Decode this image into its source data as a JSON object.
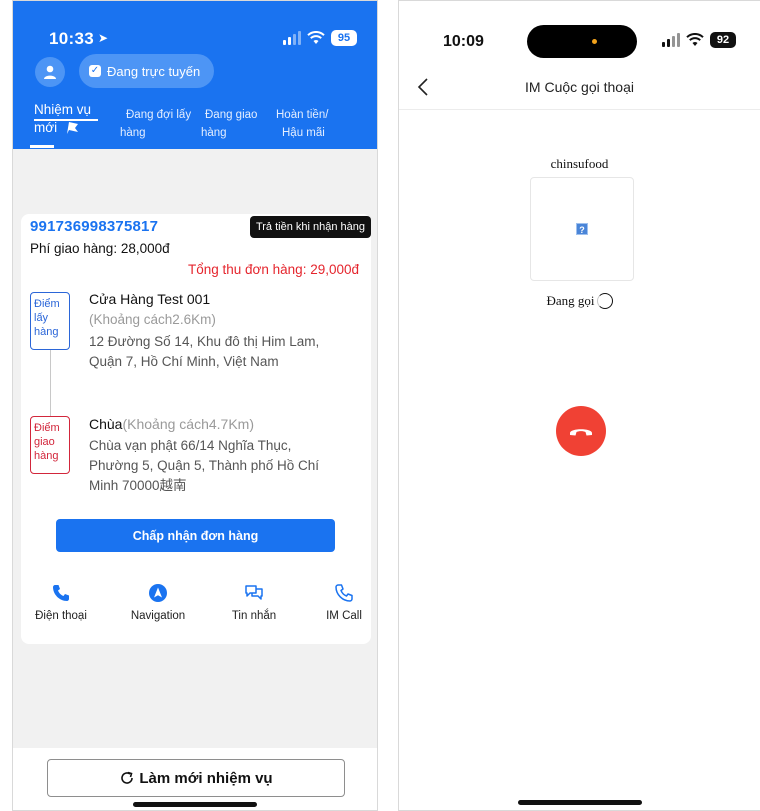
{
  "left": {
    "status": {
      "time": "10:33",
      "battery": "95"
    },
    "online_status": "Đang trực tuyến",
    "tabs": [
      {
        "line1": "Nhiệm vụ",
        "line2": "mới"
      },
      {
        "line1": "Đang đợi lấy",
        "line2": "hàng"
      },
      {
        "line1": "Đang giao",
        "line2": "hàng"
      },
      {
        "line1": "Hoàn tiền/",
        "line2": "Hậu mãi"
      }
    ],
    "order": {
      "id": "991736998375817",
      "payment_tag": "Trả tiền khi nhận hàng",
      "shipping_fee": "Phí giao hàng: 28,000đ",
      "total": "Tổng thu đơn hàng: 29,000đ",
      "pickup": {
        "tag_lines": [
          "Điểm",
          "lấy",
          "hàng"
        ],
        "name": "Cửa Hàng Test 001",
        "distance": "(Khoảng cách2.6Km)",
        "address_lines": [
          "12 Đường Số 14, Khu đô thị Him Lam,",
          "Quận 7, Hồ Chí Minh, Việt Nam"
        ]
      },
      "dropoff": {
        "tag_lines": [
          "Điểm",
          "giao",
          "hàng"
        ],
        "name": "Chùa",
        "distance": "(Khoảng cách4.7Km)",
        "address_lines": [
          "Chùa vạn phật 66/14 Nghĩa Thục,",
          "Phường 5, Quận 5, Thành phố Hồ Chí",
          "Minh 70000越南"
        ]
      },
      "accept_label": "Chấp nhận đơn hàng",
      "actions": [
        {
          "icon": "phone-icon",
          "label": "Điện thoại"
        },
        {
          "icon": "navigation-icon",
          "label": "Navigation"
        },
        {
          "icon": "chat-icon",
          "label": "Tin nhắn"
        },
        {
          "icon": "call-icon",
          "label": "IM Call"
        }
      ]
    },
    "refresh_label": "Làm mới nhiệm vụ",
    "colors": {
      "primary": "#1a73f0",
      "danger": "#e5252d",
      "pickup": "#2b66d8",
      "dropoff": "#d2263b"
    }
  },
  "right": {
    "status": {
      "time": "10:09",
      "battery": "92"
    },
    "title": "IM Cuộc gọi thoại",
    "caller_name": "chinsufood",
    "call_status": "Đang gọi",
    "colors": {
      "hangup": "#f04134"
    }
  }
}
